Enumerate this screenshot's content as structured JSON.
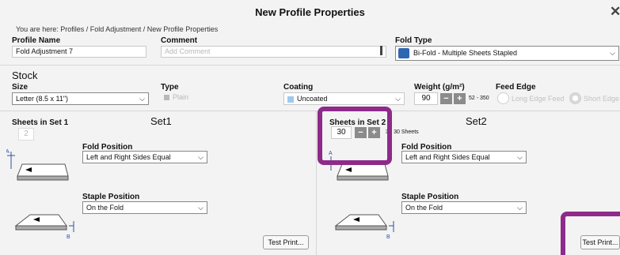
{
  "window": {
    "title": "New Profile Properties"
  },
  "breadcrumb": "You are here: Profiles / Fold Adjustment / New Profile Properties",
  "profile": {
    "name_label": "Profile Name",
    "name_value": "Fold Adjustment 7",
    "comment_label": "Comment",
    "comment_placeholder": "Add Comment",
    "fold_type_label": "Fold Type",
    "fold_type_value": "Bi-Fold - Multiple Sheets Stapled"
  },
  "stock": {
    "heading": "Stock",
    "size_label": "Size",
    "size_value": "Letter (8.5 x 11\")",
    "type_label": "Type",
    "type_value": "Plain",
    "coating_label": "Coating",
    "coating_value": "Uncoated",
    "weight_label": "Weight (g/m²)",
    "weight_value": "90",
    "weight_range": "52 - 350",
    "feed_label": "Feed Edge",
    "feed_long": "Long Edge Feed",
    "feed_short": "Short Edge Feed"
  },
  "set1": {
    "sheets_label": "Sheets in Set 1",
    "sheets_value": "2",
    "title": "Set1",
    "fold_position_label": "Fold Position",
    "fold_position_value": "Left and Right Sides Equal",
    "staple_position_label": "Staple Position",
    "staple_position_value": "On the Fold",
    "test_print": "Test Print...",
    "diagram_labels": {
      "a": "A",
      "b": "B"
    }
  },
  "set2": {
    "sheets_label": "Sheets in Set 2",
    "sheets_value": "30",
    "sheets_range": "3 - 30 Sheets",
    "title": "Set2",
    "fold_position_label": "Fold Position",
    "fold_position_value": "Left and Right Sides Equal",
    "staple_position_label": "Staple Position",
    "staple_position_value": "On the Fold",
    "test_print": "Test Print...",
    "diagram_labels": {
      "a": "A",
      "b": "B"
    }
  },
  "buttons": {
    "minus": "−",
    "plus": "+"
  },
  "colors": {
    "highlight": "#8e2a8a",
    "stepper": "#8b8b8b",
    "coating_swatch": "#9fc8ef"
  }
}
